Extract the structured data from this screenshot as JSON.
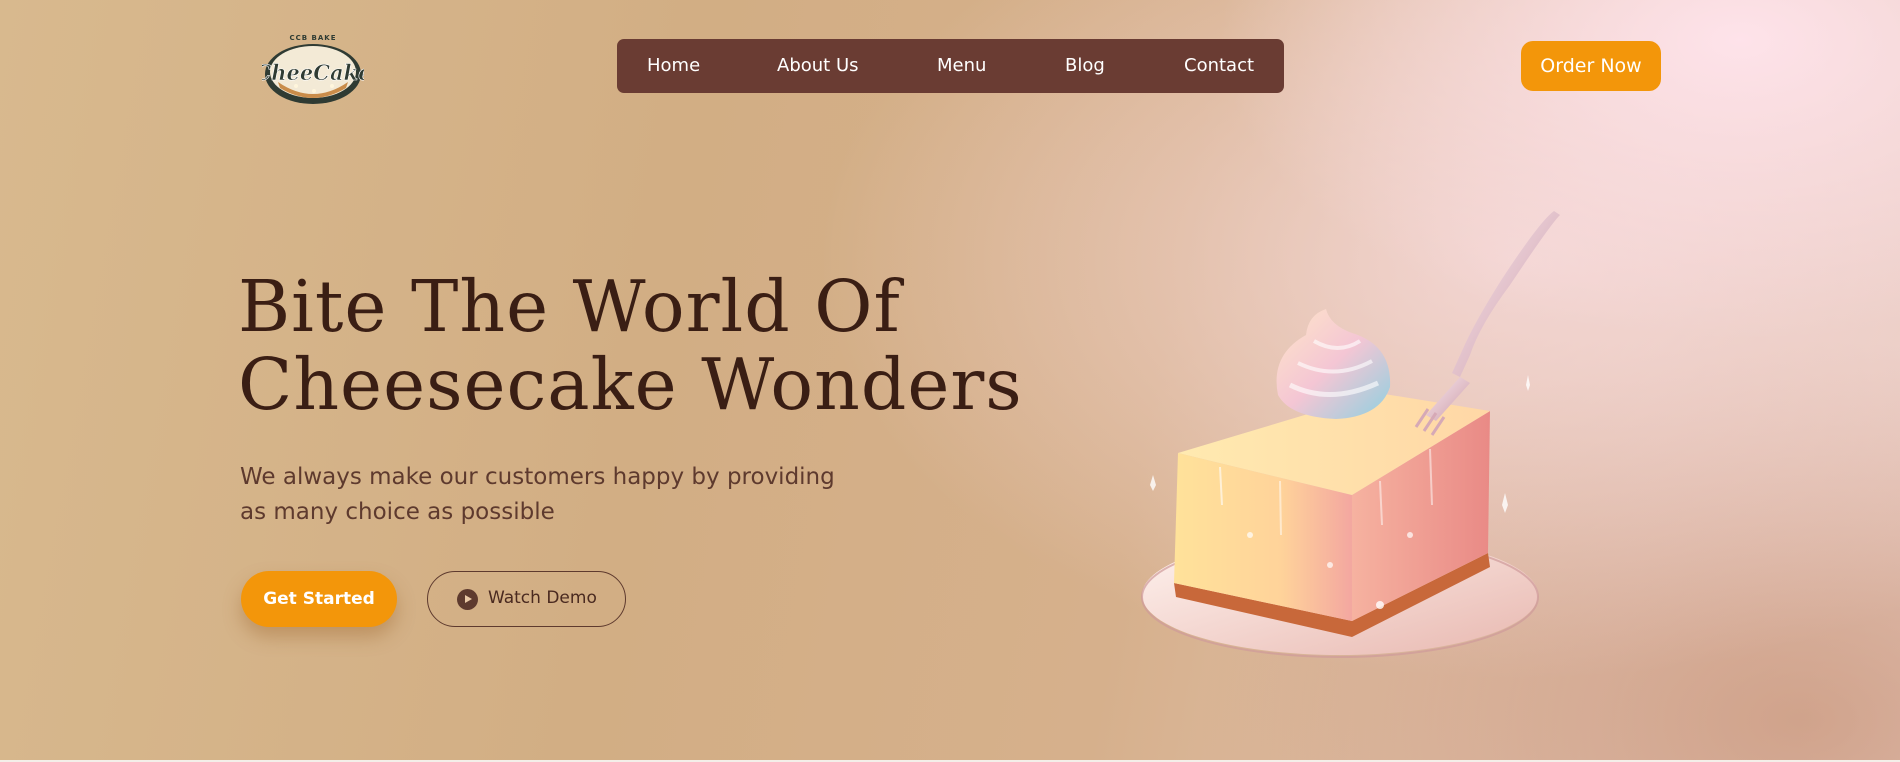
{
  "brand": {
    "logo_icon": "cheesecake-logo-icon",
    "logo_word": "CheeCake",
    "logo_arc": "CCB BAKE"
  },
  "nav": {
    "items": [
      {
        "label": "Home"
      },
      {
        "label": "About Us"
      },
      {
        "label": "Menu"
      },
      {
        "label": "Blog"
      },
      {
        "label": "Contact"
      }
    ]
  },
  "header": {
    "order_label": "Order Now"
  },
  "hero": {
    "headline_line1": "Bite The World Of",
    "headline_line2": "Cheesecake Wonders",
    "subtext_line1": "We always make our customers happy by providing",
    "subtext_line2": "as many choice as possible",
    "primary_cta": "Get Started",
    "secondary_cta": "Watch Demo",
    "secondary_icon": "play-icon",
    "image_icon": "cheesecake-slice-illustration"
  },
  "colors": {
    "accent": "#f3960a",
    "nav_bg": "#6a3c33",
    "headline": "#3a1e14",
    "body_text": "#5e3a2e",
    "background": "#d4b188"
  }
}
